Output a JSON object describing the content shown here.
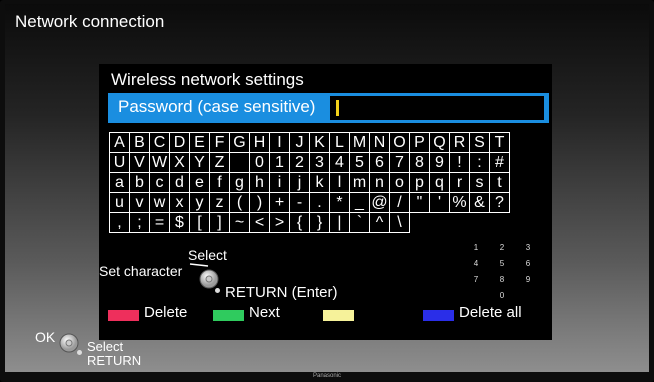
{
  "app_title": "Network connection",
  "panel": {
    "title": "Wireless network settings",
    "password_label": "Password (case sensitive)",
    "password_value": ""
  },
  "keyboard_rows": [
    [
      "A",
      "B",
      "C",
      "D",
      "E",
      "F",
      "G",
      "H",
      "I",
      "J",
      "K",
      "L",
      "M",
      "N",
      "O",
      "P",
      "Q",
      "R",
      "S",
      "T"
    ],
    [
      "U",
      "V",
      "W",
      "X",
      "Y",
      "Z",
      " ",
      "0",
      "1",
      "2",
      "3",
      "4",
      "5",
      "6",
      "7",
      "8",
      "9",
      "!",
      ":",
      "#"
    ],
    [
      "a",
      "b",
      "c",
      "d",
      "e",
      "f",
      "g",
      "h",
      "i",
      "j",
      "k",
      "l",
      "m",
      "n",
      "o",
      "p",
      "q",
      "r",
      "s",
      "t"
    ],
    [
      "u",
      "v",
      "w",
      "x",
      "y",
      "z",
      "(",
      ")",
      "+",
      "-",
      ".",
      "*",
      "_",
      "@",
      "/",
      "\"",
      "'",
      "%",
      "&",
      "?"
    ],
    [
      ",",
      ";",
      "=",
      "$",
      "[",
      "]",
      "~",
      "<",
      ">",
      "{",
      "}",
      "|",
      "`",
      "^",
      "\\"
    ]
  ],
  "numpad": [
    "1",
    "2",
    "3",
    "4",
    "5",
    "6",
    "7",
    "8",
    "9",
    "0"
  ],
  "help": {
    "select": "Select",
    "set_character": "Set character",
    "return_enter": "RETURN (Enter)"
  },
  "color_keys": [
    {
      "label": "Delete",
      "color": "#ee2f5c"
    },
    {
      "label": "Next",
      "color": "#2fcb5e"
    },
    {
      "label": "",
      "color": "#f6f29a"
    },
    {
      "label": "Delete all",
      "color": "#2a2ee8"
    }
  ],
  "bottom": {
    "ok": "OK",
    "select": "Select",
    "return": "RETURN"
  },
  "brand": "Panasonic"
}
